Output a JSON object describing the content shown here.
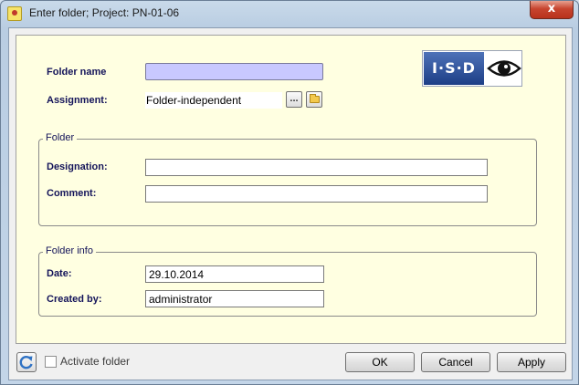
{
  "window": {
    "title": "Enter folder; Project: PN-01-06",
    "close_glyph": "x"
  },
  "form": {
    "folder_name": {
      "label": "Folder name",
      "value": ""
    },
    "assignment": {
      "label": "Assignment:",
      "value": "Folder-independent",
      "browse_label": "..."
    },
    "folder_group": {
      "legend": "Folder",
      "designation": {
        "label": "Designation:",
        "value": ""
      },
      "comment": {
        "label": "Comment:",
        "value": ""
      }
    },
    "info_group": {
      "legend": "Folder info",
      "date": {
        "label": "Date:",
        "value": "29.10.2014"
      },
      "created_by": {
        "label": "Created by:",
        "value": "administrator"
      }
    }
  },
  "logo": {
    "text": "I·S·D",
    "icon": "eye-icon"
  },
  "footer": {
    "activate_label": "Activate folder",
    "activate_checked": false,
    "ok_label": "OK",
    "cancel_label": "Cancel",
    "apply_label": "Apply"
  },
  "colors": {
    "panel": "#ffffe1",
    "required_field": "#c8c8ff",
    "label": "#14145a",
    "close_button": "#c7452f"
  }
}
